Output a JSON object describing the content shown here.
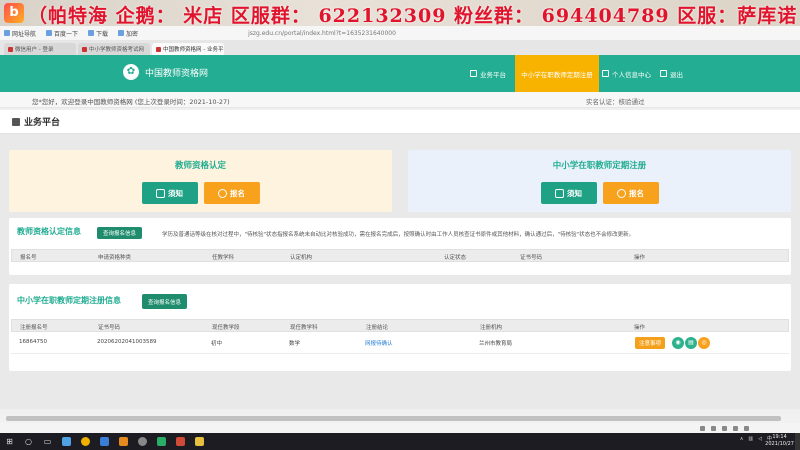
{
  "banner": {
    "logo_glyph": "b",
    "text": "（帕特海 企鹅： 米店 区服群： 622132309   粉丝群： 694404789  区服：萨库诺"
  },
  "browser": {
    "bookmarks": [
      "网址导航",
      "百度一下",
      "下载",
      "加密"
    ],
    "tabs": [
      "微信用户 - 登录",
      "中小学教师资格考试网",
      "中国教师资格网 - 业务平台"
    ],
    "active_tab": 2,
    "url_text": "jszg.edu.cn/portal/index.html?t=1635231640000"
  },
  "header": {
    "site_title": "中国教师资格网",
    "logo_glyph": "✿",
    "nav": [
      {
        "label": "业务平台"
      },
      {
        "label": "中小学在职教师定期注册"
      },
      {
        "label": "个人信息中心"
      },
      {
        "label": "退出"
      }
    ],
    "accent": "#23ad92",
    "active_color": "#f8b300"
  },
  "welcome": {
    "message": "您*您好，欢迎登录中国教师资格网 (您上次登录时间：2021-10-27)",
    "status": "实名认证：核验通过"
  },
  "page": {
    "title": "业务平台"
  },
  "cards": {
    "cert": {
      "title": "教师资格认定",
      "notice": "须知",
      "apply": "报名"
    },
    "reg": {
      "title": "中小学在职教师定期注册",
      "notice": "须知",
      "apply": "报名"
    }
  },
  "cert_info": {
    "title": "教师资格认定信息",
    "query_button": "查询报名信息",
    "note": "学历及普通话等级在核对过程中，\"待核验\"状态指报名系统未自动比对核验成功，需在报名完成后，按照确认时由工作人员核查证书原件或其他材料，确认通过后，\"待核验\"状态也不会修改更新。",
    "columns": [
      "报名号",
      "申请资格种类",
      "任教学科",
      "认定机构",
      "认定状态",
      "证书号码",
      "操作"
    ]
  },
  "reg_info": {
    "title": "中小学在职教师定期注册信息",
    "query_button": "查询报名信息",
    "columns": [
      "注册报名号",
      "证书号码",
      "现任教学段",
      "现任教学科",
      "注册结论",
      "注册机构",
      "操作"
    ],
    "rows": [
      {
        "reg_no": "16864750",
        "cert_no": "20206202041003589",
        "stage": "初中",
        "subject": "数学",
        "conclusion": "网报待确认",
        "org": "兰州市教育局",
        "action": "注意事项"
      }
    ]
  },
  "taskbar": {
    "time": "19:14",
    "date": "2021/10/27",
    "lang": "中"
  }
}
